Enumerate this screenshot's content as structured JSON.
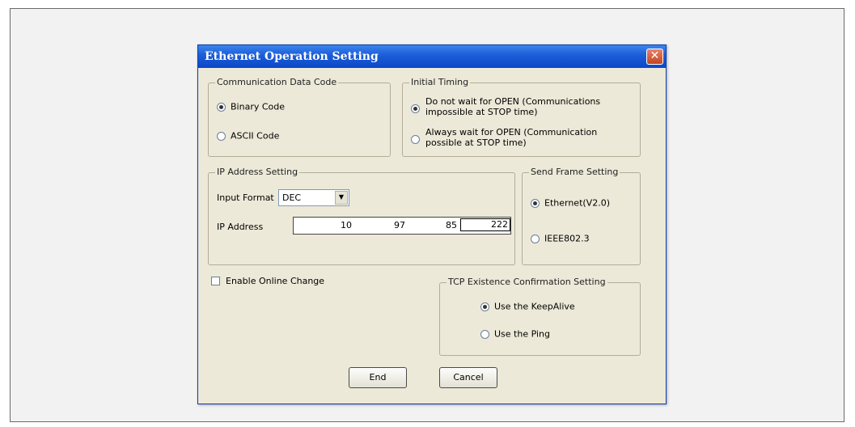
{
  "dialog": {
    "title": "Ethernet Operation Setting",
    "close_symbol": "✕",
    "comm_code": {
      "label": "Communication Data Code",
      "options": [
        "Binary Code",
        "ASCII Code"
      ],
      "selected": "Binary Code"
    },
    "initial_timing": {
      "label": "Initial Timing",
      "options": [
        {
          "line1": "Do not wait for OPEN (Communications",
          "line2": "impossible at STOP time)"
        },
        {
          "line1": "Always wait for OPEN (Communication",
          "line2": "possible at STOP time)"
        }
      ],
      "selected_index": 0
    },
    "ip_setting": {
      "label": "IP Address Setting",
      "input_format_label": "Input Format",
      "input_format_value": "DEC",
      "ip_label": "IP Address",
      "octets": [
        "10",
        "97",
        "85",
        "222"
      ]
    },
    "send_frame": {
      "label": "Send Frame Setting",
      "options": [
        "Ethernet(V2.0)",
        "IEEE802.3"
      ],
      "selected": "Ethernet(V2.0)"
    },
    "online_change": {
      "label": "Enable Online Change",
      "checked": false
    },
    "tcp_confirm": {
      "label": "TCP Existence Confirmation Setting",
      "options": [
        "Use the KeepAlive",
        "Use the Ping"
      ],
      "selected": "Use the KeepAlive"
    },
    "buttons": {
      "end": "End",
      "cancel": "Cancel"
    }
  }
}
